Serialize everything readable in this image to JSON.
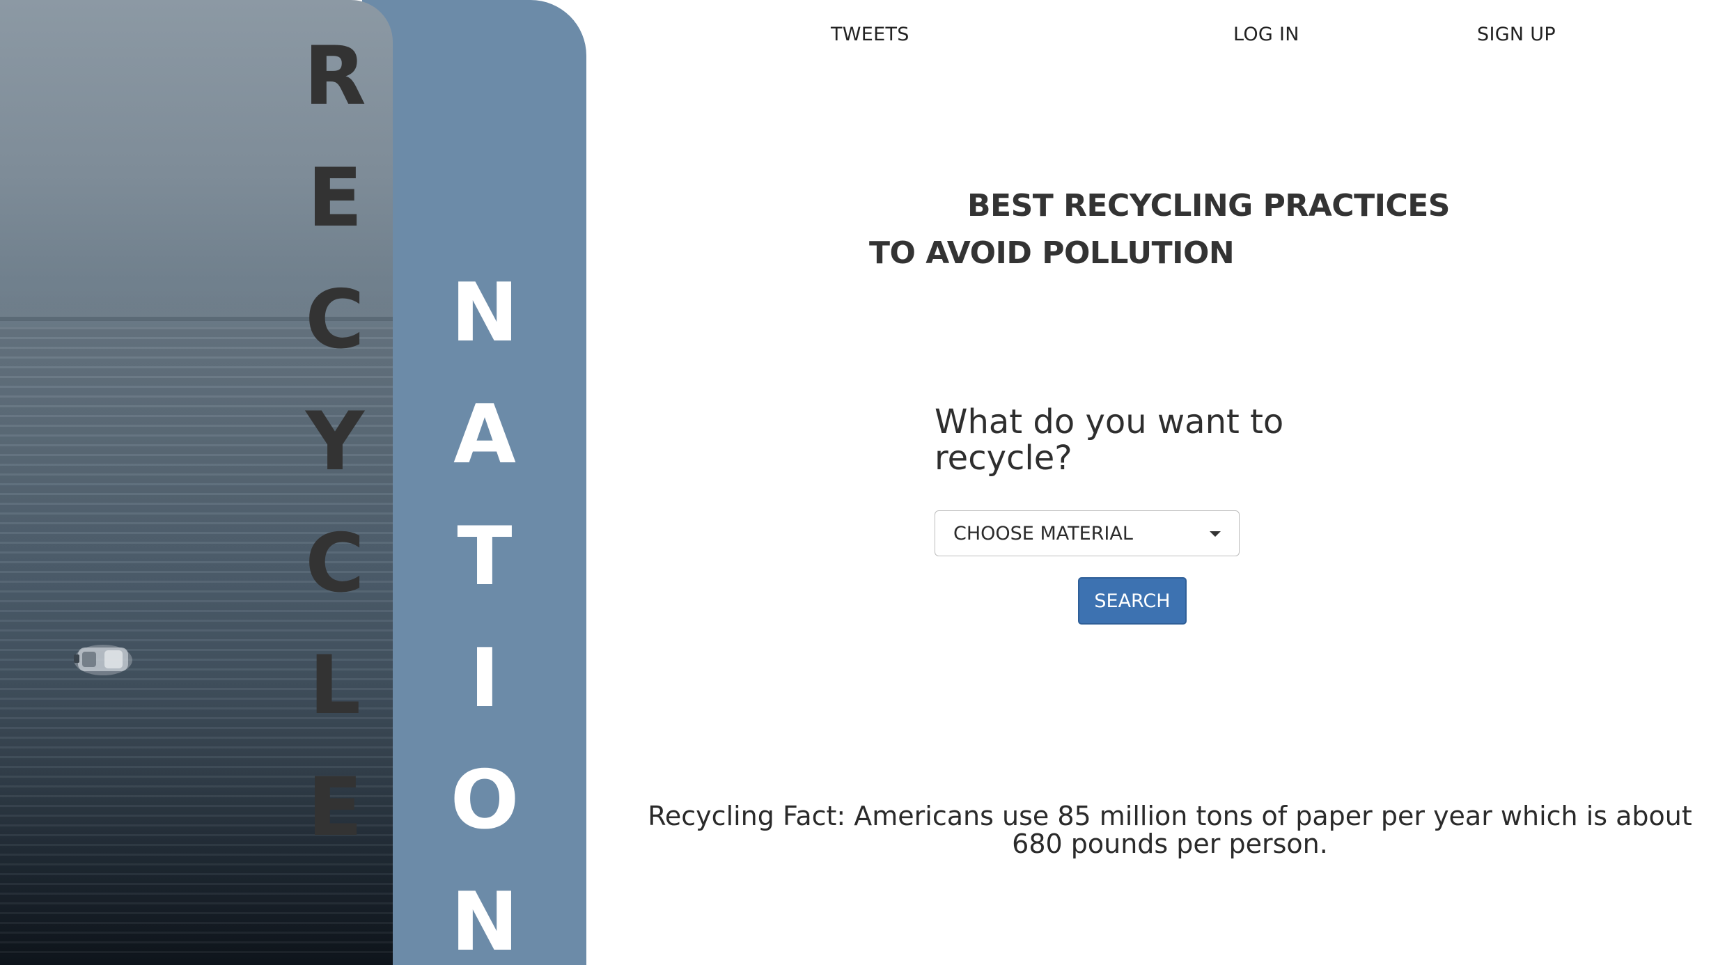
{
  "brand": {
    "word_left": "RECYCLE",
    "word_right": "NATION",
    "accent_color": "#6c8ba8"
  },
  "nav": {
    "tweets": "TWEETS",
    "login": "LOG IN",
    "signup": "SIGN UP"
  },
  "headline": {
    "line1": "BEST RECYCLING PRACTICES",
    "line2": "TO AVOID POLLUTION"
  },
  "form": {
    "question": "What do you want to recycle?",
    "select_value": "CHOOSE MATERIAL",
    "search_label": "SEARCH",
    "button_color": "#3d72b1"
  },
  "fact": {
    "text": "Recycling Fact: Americans use 85 million tons of paper per year which is about 680 pounds per person."
  }
}
